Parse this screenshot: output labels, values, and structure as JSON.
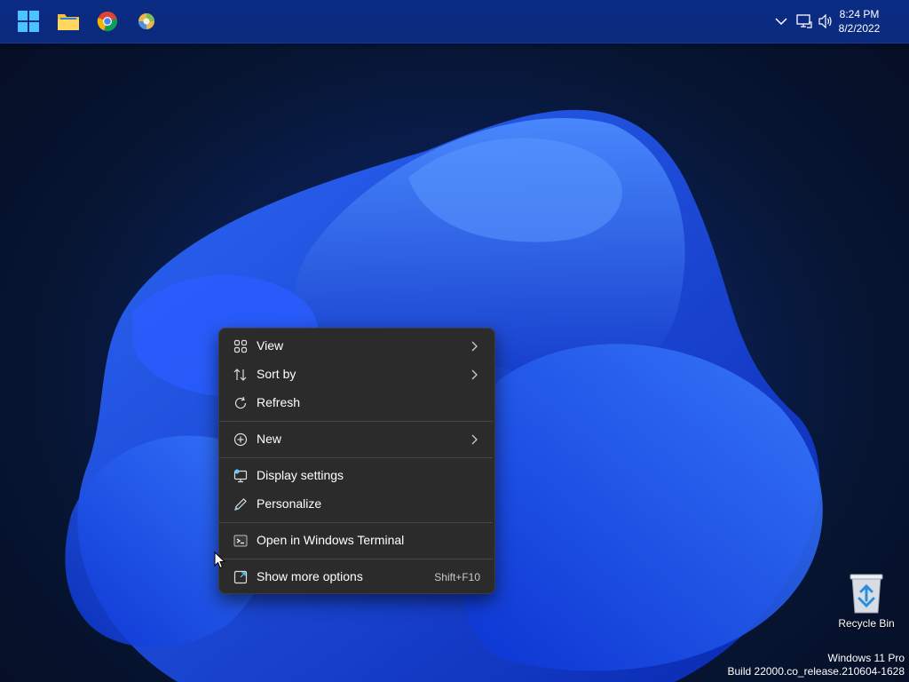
{
  "taskbar": {
    "apps": [
      {
        "name": "start-button"
      },
      {
        "name": "file-explorer"
      },
      {
        "name": "chrome"
      },
      {
        "name": "app"
      }
    ],
    "clock": {
      "time": "8:24 PM",
      "date": "8/2/2022"
    }
  },
  "context_menu": {
    "items": [
      {
        "id": "view",
        "label": "View",
        "icon": "grid-icon",
        "submenu": true
      },
      {
        "id": "sort-by",
        "label": "Sort by",
        "icon": "sort-arrows-icon",
        "submenu": true
      },
      {
        "id": "refresh",
        "label": "Refresh",
        "icon": "refresh-icon",
        "submenu": false
      },
      {
        "id": "new",
        "label": "New",
        "icon": "plus-circle-icon",
        "submenu": true
      },
      {
        "id": "display-settings",
        "label": "Display settings",
        "icon": "display-icon",
        "submenu": false
      },
      {
        "id": "personalize",
        "label": "Personalize",
        "icon": "pen-icon",
        "submenu": false
      },
      {
        "id": "open-terminal",
        "label": "Open in Windows Terminal",
        "icon": "terminal-icon",
        "submenu": false
      },
      {
        "id": "show-more-options",
        "label": "Show more options",
        "icon": "expand-icon",
        "shortcut": "Shift+F10"
      }
    ]
  },
  "desktop": {
    "recycle_bin_label": "Recycle Bin",
    "watermark": {
      "line1": "Windows 11 Pro",
      "line2": "Build 22000.co_release.210604-1628"
    }
  },
  "colors": {
    "accent": "#60cdff",
    "menu_bg": "#2b2b2b",
    "taskbar": "#0a2a7d"
  }
}
